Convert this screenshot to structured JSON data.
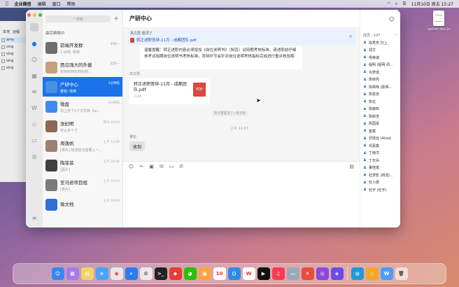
{
  "menubar": {
    "items": [
      "企业微信",
      "编辑",
      "窗口",
      "帮助"
    ],
    "clock": "11月10日 周五 15:27"
  },
  "desktop": {
    "file_name": "option-dev.js"
  },
  "background_window": {
    "tabs": [
      "本地",
      "远程"
    ],
    "rows": [
      "ama",
      "sing",
      "sing",
      "sing",
      "sing"
    ]
  },
  "wechat": {
    "search_placeholder": "搜索",
    "chats": [
      {
        "name": "最后略略中",
        "preview": "",
        "time": ""
      },
      {
        "name": "前端开发群",
        "preview": "1 出现, 收到",
        "time": "星期一"
      },
      {
        "name": "西瓜强大的外援",
        "preview": "收到收到收到收到…",
        "time": "星期一"
      },
      {
        "name": "产研中心",
        "preview": "曹松: 收到",
        "time": "3分钟前"
      },
      {
        "name": "微盘",
        "preview": "你上传了1个文件到【w…",
        "time": "4分钟前"
      },
      {
        "name": "张纪明",
        "preview": "可以多个了",
        "time": "昨天 16:04"
      },
      {
        "name": "周逸帆",
        "preview": "[表片] 检测您也需要入一…",
        "time": "上午 11:05"
      },
      {
        "name": "陶菲菲",
        "preview": "[图片]",
        "time": "上午 10:41"
      },
      {
        "name": "亚马逊项目组",
        "preview": "[表片]",
        "time": "上午 10:20"
      },
      {
        "name": "微文档",
        "preview": "",
        "time": "上午 10:09"
      }
    ],
    "chat_title": "产研中心",
    "pinned": {
      "line1": "高文慧 置顶了",
      "file": "转正述职答辩-11月 - 成都团队.pdf",
      "close": "×"
    },
    "notice_text": "温馨提醒：转正述职内容必须增加《岗位说明书》（知否）试用期考核标准，请述职前仔细参考试用期岗位说明书考核标准，答辩环节会针对岗位说明考核指标完成进行重点核验哦",
    "file_sender": "高文慧",
    "file_card": {
      "name": "转正述职答辩-11月 - 成都团队.pdf",
      "size": "235K",
      "badge": "PDF"
    },
    "system_msg": "高文慧置顶了一条消息",
    "timestamp": "上午 11:07",
    "reply_sender": "曹松",
    "reply_text": "收到",
    "members_count": "成员 · 197",
    "members_more": "···",
    "members": [
      "陈秀芳 扫上",
      "郑文",
      "杨荣诚",
      "程明 (程明 研…",
      "许梦成",
      "陈晓亮",
      "陈辉辉 (陈辉…",
      "陈俊安",
      "陈龙",
      "陈敏知",
      "陈新虎",
      "陈国豪",
      "崔斌",
      "邓逸远 (Alisa)",
      "邓嘉鑫",
      "丁雨洋",
      "丁天兵",
      "董桂斌",
      "杜梦影 (物流/…",
      "杜小惠",
      "杜宇 (杜宇)"
    ]
  },
  "colors": {
    "accent": "#1a73e8",
    "pdf": "#d84a3d"
  }
}
